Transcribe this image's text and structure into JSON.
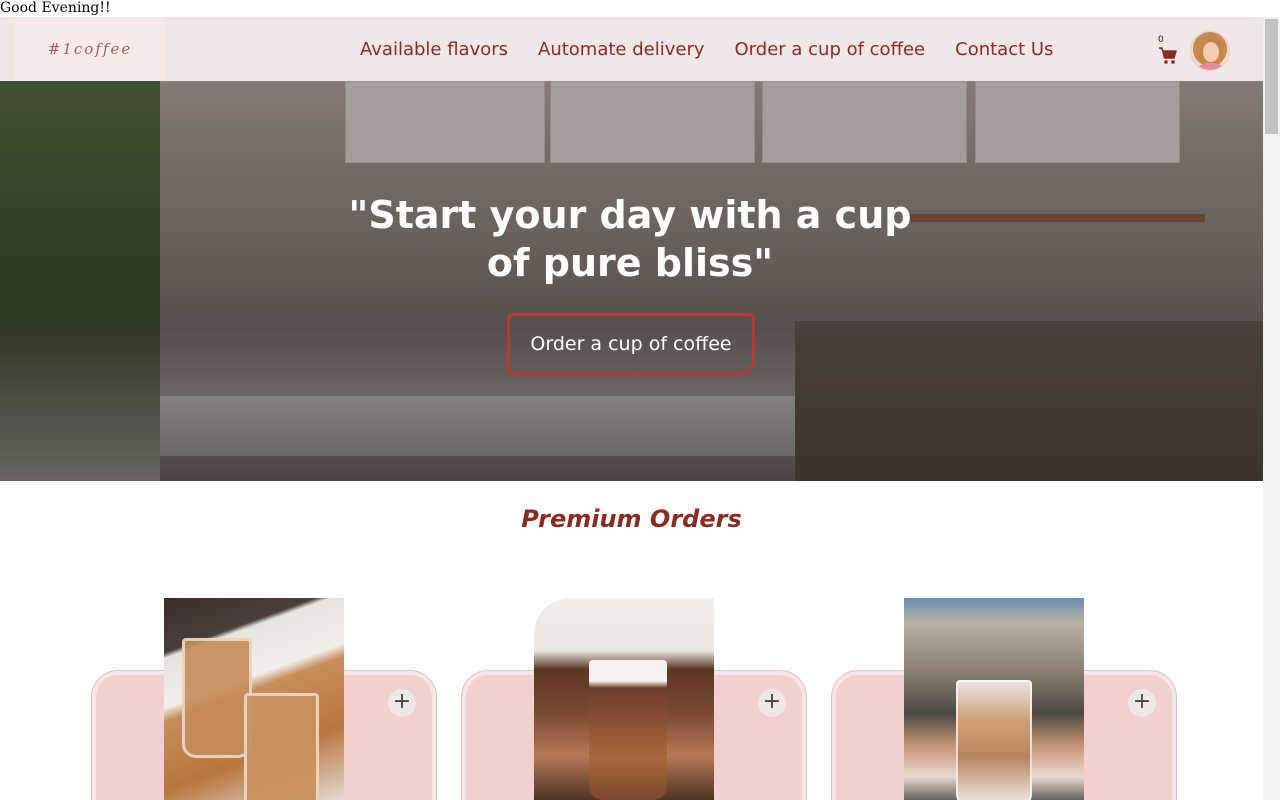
{
  "greeting": "Good Evening!!",
  "brand": {
    "logo": "#1coffee"
  },
  "nav": {
    "links": [
      {
        "label": "Available flavors"
      },
      {
        "label": "Automate delivery"
      },
      {
        "label": "Order a cup of coffee"
      },
      {
        "label": "Contact Us"
      }
    ],
    "cart_count": "0"
  },
  "hero": {
    "title": "\"Start your day with a cup of pure bliss\"",
    "button_label": "Order a cup of coffee"
  },
  "premium": {
    "title": "Premium Orders",
    "cards": [
      {
        "add_label": "+"
      },
      {
        "add_label": "+"
      },
      {
        "add_label": "+"
      }
    ]
  },
  "colors": {
    "accent": "#8a2a24",
    "nav_background": "#f0e7e8",
    "card_background": "#f4cfcf",
    "button_border": "#b83a37"
  },
  "icons": {
    "cart": "shopping-cart-icon",
    "add": "plus-icon"
  }
}
